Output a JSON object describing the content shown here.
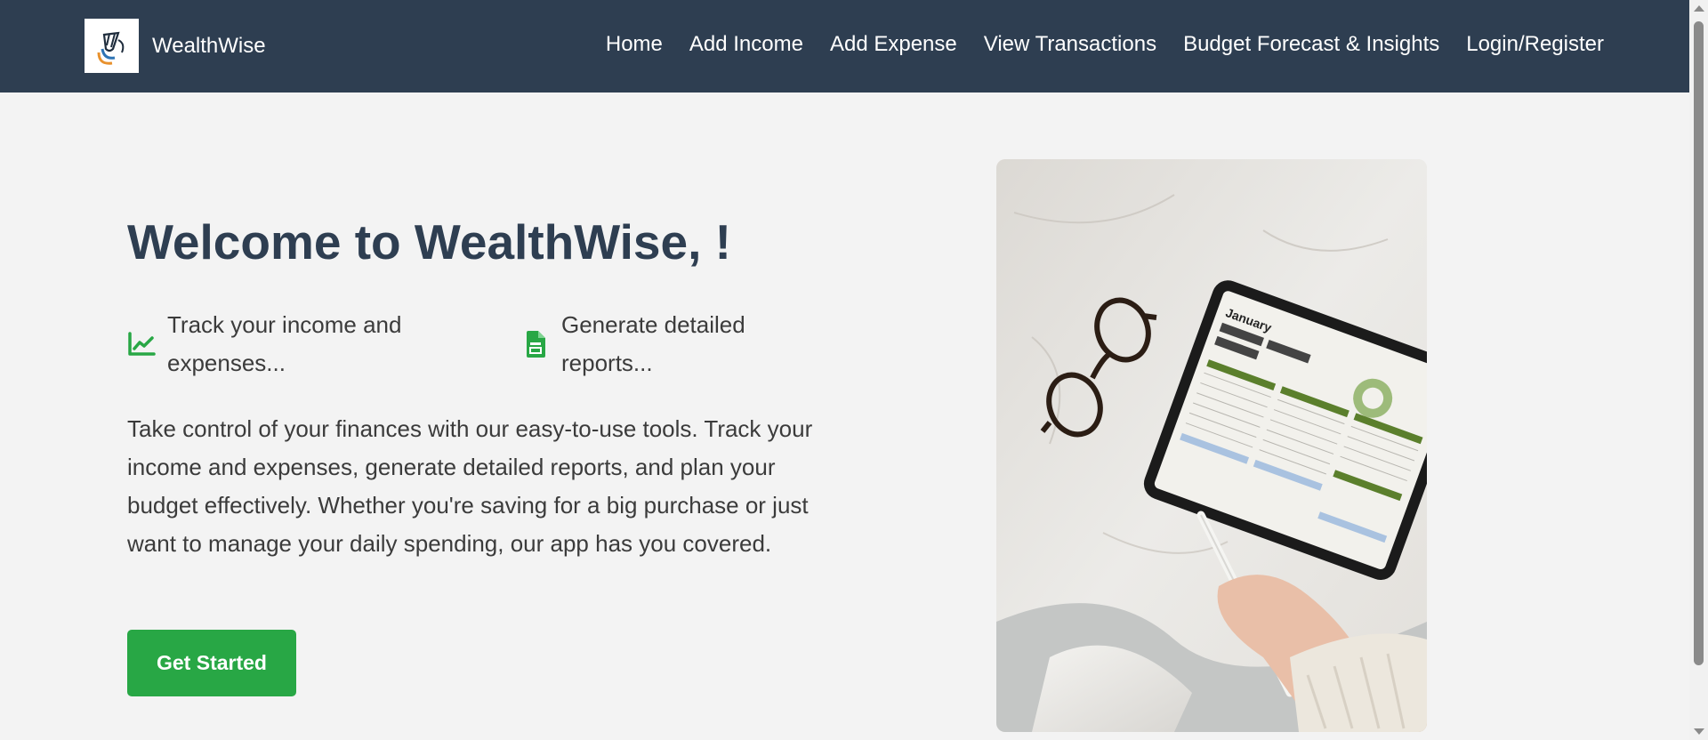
{
  "brand": {
    "name": "WealthWise",
    "logo_icon": "wealthwise-logo"
  },
  "nav": {
    "links": [
      {
        "label": "Home"
      },
      {
        "label": "Add Income"
      },
      {
        "label": "Add Expense"
      },
      {
        "label": "View Transactions"
      },
      {
        "label": "Budget Forecast & Insights"
      },
      {
        "label": "Login/Register"
      }
    ]
  },
  "hero": {
    "title": "Welcome to WealthWise, !",
    "features": [
      {
        "icon": "line-chart-icon",
        "text": "Track your income and expenses..."
      },
      {
        "icon": "document-icon",
        "text": "Generate detailed reports..."
      }
    ],
    "description": "Take control of your finances with our easy-to-use tools. Track your income and expenses, generate detailed reports, and plan your budget effectively. Whether you're saving for a big purchase or just want to manage your daily spending, our app has you covered.",
    "cta_label": "Get Started"
  },
  "tablet_screen": {
    "month": "January"
  },
  "colors": {
    "navbar": "#2e3e51",
    "accent": "#28a745",
    "background": "#f3f3f3",
    "title": "#2e3e51"
  }
}
